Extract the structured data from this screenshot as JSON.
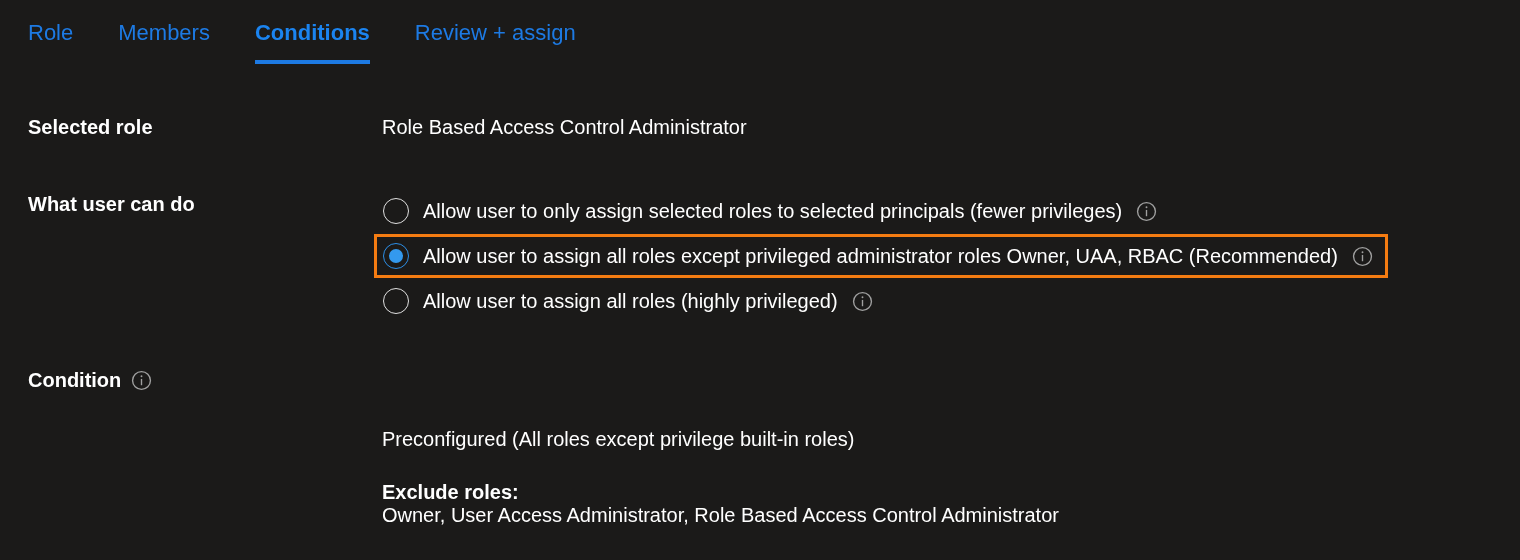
{
  "tabs": [
    {
      "label": "Role",
      "selected": false
    },
    {
      "label": "Members",
      "selected": false
    },
    {
      "label": "Conditions",
      "selected": true
    },
    {
      "label": "Review + assign",
      "selected": false
    }
  ],
  "selected_role": {
    "label": "Selected role",
    "value": "Role Based Access Control Administrator"
  },
  "what_user_can_do": {
    "label": "What user can do",
    "options": [
      {
        "label": "Allow user to only assign selected roles to selected principals (fewer privileges)",
        "selected": false,
        "highlighted": false
      },
      {
        "label": "Allow user to assign all roles except privileged administrator roles Owner, UAA, RBAC (Recommended)",
        "selected": true,
        "highlighted": true
      },
      {
        "label": "Allow user to assign all roles (highly privileged)",
        "selected": false,
        "highlighted": false
      }
    ]
  },
  "condition": {
    "label": "Condition",
    "summary": "Preconfigured (All roles except privilege built-in roles)",
    "exclude_heading": "Exclude roles:",
    "exclude_value": "Owner, User Access Administrator, Role Based Access Control Administrator"
  }
}
